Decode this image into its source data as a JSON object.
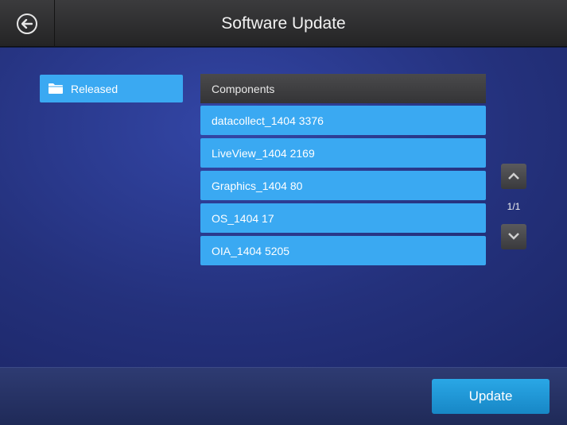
{
  "header": {
    "title": "Software Update",
    "back_icon": "back-arrow-icon"
  },
  "sidebar": {
    "folder_label": "Released",
    "folder_icon": "folder-icon"
  },
  "components": {
    "header_label": "Components",
    "items": [
      "datacollect_1404 3376",
      "LiveView_1404 2169",
      "Graphics_1404 80",
      "OS_1404 17",
      "OIA_1404 5205"
    ]
  },
  "pagination": {
    "indicator": "1/1",
    "up_icon": "chevron-up-icon",
    "down_icon": "chevron-down-icon"
  },
  "footer": {
    "update_label": "Update"
  },
  "colors": {
    "accent": "#3aa9f2",
    "header_bg": "#2f2f31",
    "background": "#24317c",
    "update_button": "#1f97d6"
  }
}
